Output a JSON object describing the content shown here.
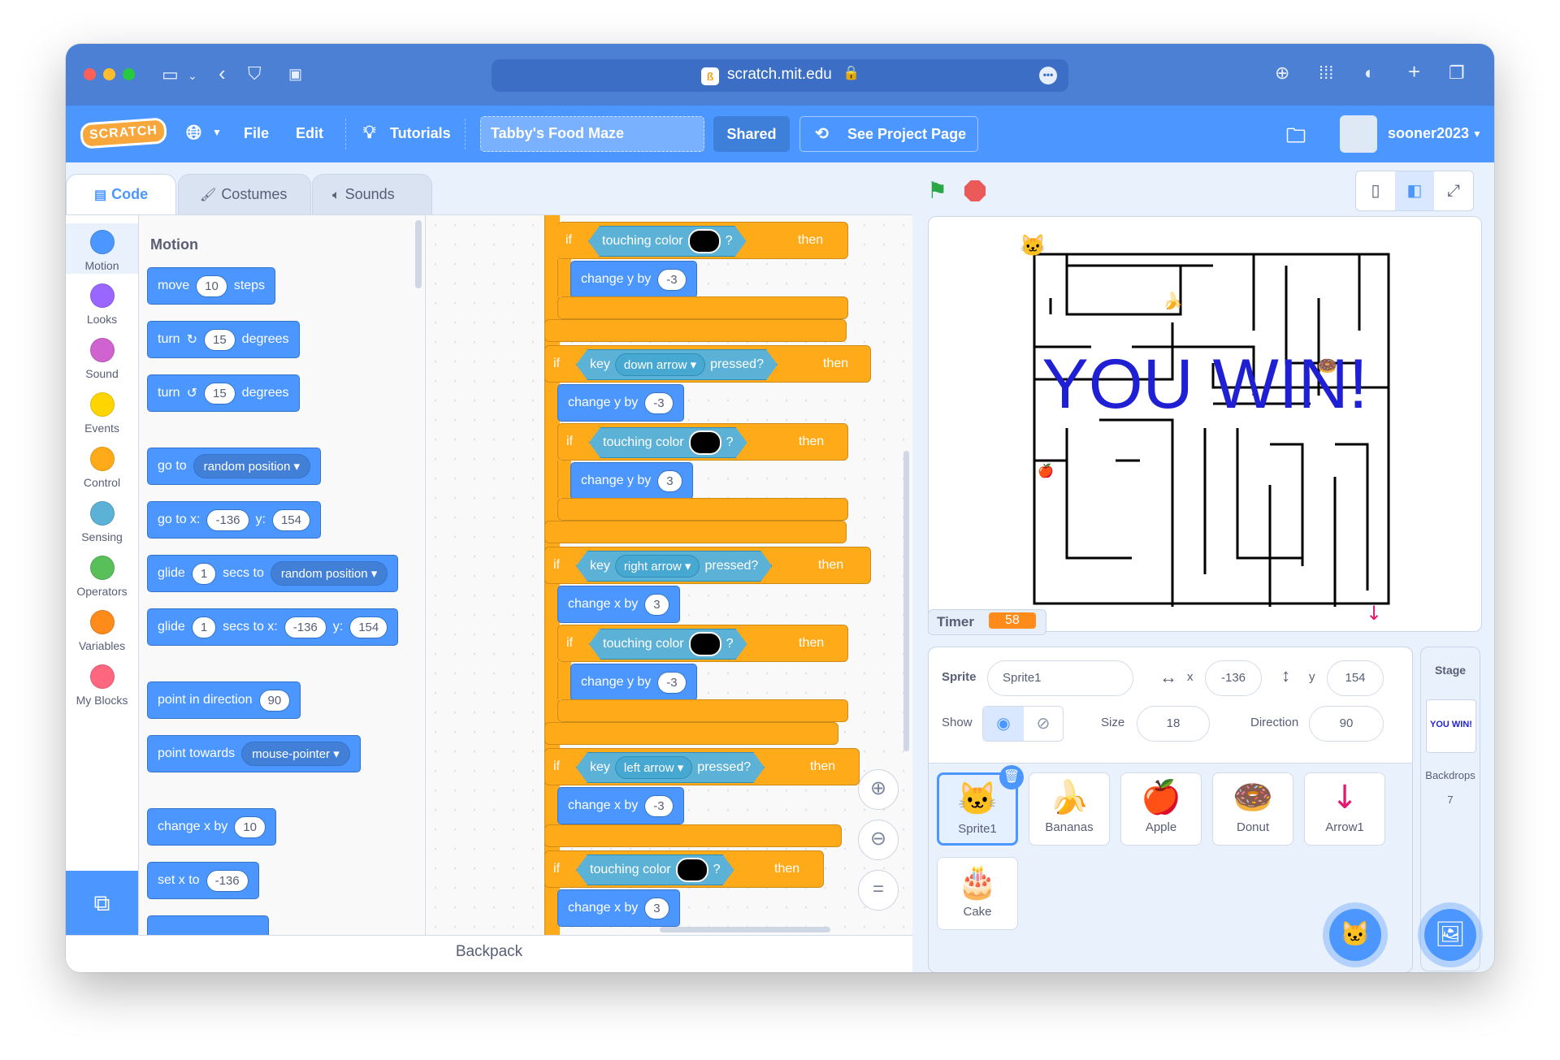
{
  "browser": {
    "url": "scratch.mit.edu"
  },
  "menu": {
    "file": "File",
    "edit": "Edit",
    "tutorials": "Tutorials",
    "project_title": "Tabby's Food Maze",
    "shared": "Shared",
    "see_project": "See Project Page",
    "username": "sooner2023"
  },
  "tabs": {
    "code": "Code",
    "costumes": "Costumes",
    "sounds": "Sounds"
  },
  "categories": [
    "Motion",
    "Looks",
    "Sound",
    "Events",
    "Control",
    "Sensing",
    "Operators",
    "Variables",
    "My Blocks"
  ],
  "category_colors": [
    "#4c97ff",
    "#9966ff",
    "#cf63cf",
    "#ffd500",
    "#ffab19",
    "#5cb1d6",
    "#59c059",
    "#ff8c1a",
    "#ff6680"
  ],
  "palette": {
    "title": "Motion",
    "move": {
      "a": "move",
      "v": "10",
      "b": "steps"
    },
    "turn_right": {
      "a": "turn",
      "v": "15",
      "b": "degrees"
    },
    "turn_left": {
      "a": "turn",
      "v": "15",
      "b": "degrees"
    },
    "goto": {
      "a": "go to",
      "dd": "random position"
    },
    "gotoxy": {
      "a": "go to x:",
      "x": "-136",
      "b": "y:",
      "y": "154"
    },
    "glide1": {
      "a": "glide",
      "v": "1",
      "b": "secs to",
      "dd": "random position"
    },
    "glide2": {
      "a": "glide",
      "v": "1",
      "b": "secs to x:",
      "x": "-136",
      "c": "y:",
      "y": "154"
    },
    "point_dir": {
      "a": "point in direction",
      "v": "90"
    },
    "point_towards": {
      "a": "point towards",
      "dd": "mouse-pointer"
    },
    "change_x": {
      "a": "change x by",
      "v": "10"
    },
    "set_x": {
      "a": "set x to",
      "v": "-136"
    }
  },
  "script": {
    "if": "if",
    "then": "then",
    "key": "key",
    "pressed": "pressed?",
    "touching_color": "touching color",
    "q": "?",
    "change_y": "change y by",
    "change_x": "change x by",
    "down_arrow": "down arrow",
    "right_arrow": "right arrow",
    "left_arrow": "left arrow",
    "v_neg3": "-3",
    "v_3": "3"
  },
  "backpack": "Backpack",
  "stage": {
    "win_text": "YOU WIN!",
    "timer_label": "Timer",
    "timer_value": "58"
  },
  "sprite_info": {
    "sprite_label": "Sprite",
    "sprite_name": "Sprite1",
    "x_label": "x",
    "x": "-136",
    "y_label": "y",
    "y": "154",
    "show_label": "Show",
    "size_label": "Size",
    "size": "18",
    "direction_label": "Direction",
    "direction": "90"
  },
  "sprites": [
    "Sprite1",
    "Bananas",
    "Apple",
    "Donut",
    "Arrow1",
    "Cake"
  ],
  "stage_panel": {
    "title": "Stage",
    "backdrops_label": "Backdrops",
    "backdrops_count": "7",
    "thumb_text": "YOU WIN!"
  }
}
